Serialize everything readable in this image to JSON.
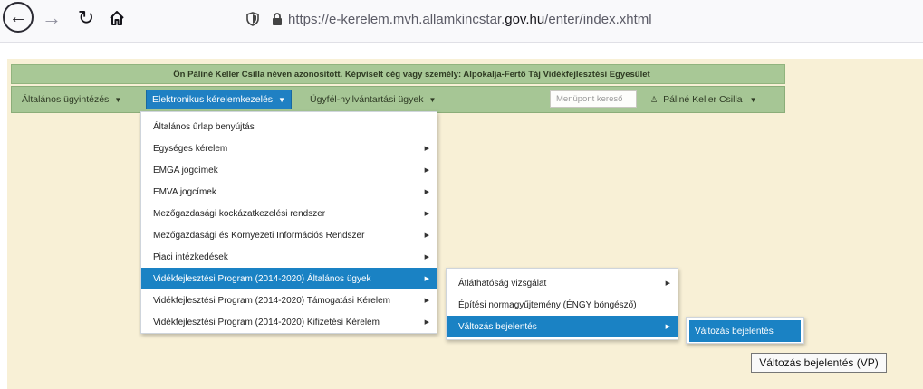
{
  "browser": {
    "url_prefix": "https://e-kerelem.mvh.allamkincstar.",
    "url_domain": "gov.hu",
    "url_path": "/enter/index.xhtml"
  },
  "infobar": {
    "text": "Ön Páliné Keller Csilla néven azonosított.  Képviselt cég vagy személy: Alpokalja-Fertő Táj Vidékfejlesztési Egyesület"
  },
  "menu": {
    "items": [
      {
        "label": "Általános ügyintézés"
      },
      {
        "label": "Elektronikus kérelemkezelés"
      },
      {
        "label": "Ügyfél-nyilvántartási ügyek"
      }
    ],
    "search_placeholder": "Menüpont kereső",
    "user_label": "Páliné Keller Csilla"
  },
  "dropdown1": [
    {
      "label": "Általános űrlap benyújtás",
      "sub": false
    },
    {
      "label": "Egységes kérelem",
      "sub": true
    },
    {
      "label": "EMGA jogcímek",
      "sub": true
    },
    {
      "label": "EMVA jogcímek",
      "sub": true
    },
    {
      "label": "Mezőgazdasági kockázatkezelési rendszer",
      "sub": true
    },
    {
      "label": "Mezőgazdasági és Környezeti Információs Rendszer",
      "sub": true
    },
    {
      "label": "Piaci intézkedések",
      "sub": true
    },
    {
      "label": "Vidékfejlesztési Program (2014-2020) Általános ügyek",
      "sub": true,
      "selected": true
    },
    {
      "label": "Vidékfejlesztési Program (2014-2020) Támogatási Kérelem",
      "sub": true
    },
    {
      "label": "Vidékfejlesztési Program (2014-2020) Kifizetési Kérelem",
      "sub": true
    }
  ],
  "dropdown2": [
    {
      "label": "Átláthatóság vizsgálat",
      "sub": true
    },
    {
      "label": "Építési normagyűjtemény (ÉNGY böngésző)",
      "sub": false
    },
    {
      "label": "Változás bejelentés",
      "sub": true,
      "selected": true
    }
  ],
  "dropdown3": [
    {
      "label": "Változás bejelentés",
      "selected": true
    }
  ],
  "tooltip": "Változás bejelentés (VP)"
}
